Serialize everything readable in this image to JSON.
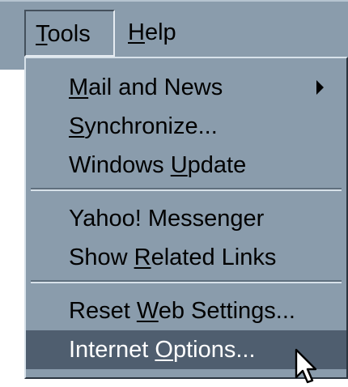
{
  "menubar": {
    "tools_label": "Tools",
    "help_label": "Help"
  },
  "tools_menu": {
    "items": [
      {
        "label": "Mail and News",
        "has_submenu": true
      },
      {
        "label": "Synchronize..."
      },
      {
        "label": "Windows Update"
      },
      {
        "label": "Yahoo! Messenger"
      },
      {
        "label": "Show Related Links"
      },
      {
        "label": "Reset Web Settings..."
      },
      {
        "label": "Internet Options...",
        "highlighted": true
      }
    ]
  },
  "icons": {
    "submenu_arrow": "triangle-right-icon",
    "cursor": "mouse-pointer-icon"
  },
  "colors": {
    "menu_background": "#8a9cac",
    "highlight_background": "#4f5e6f",
    "highlight_text": "#ffffff"
  }
}
